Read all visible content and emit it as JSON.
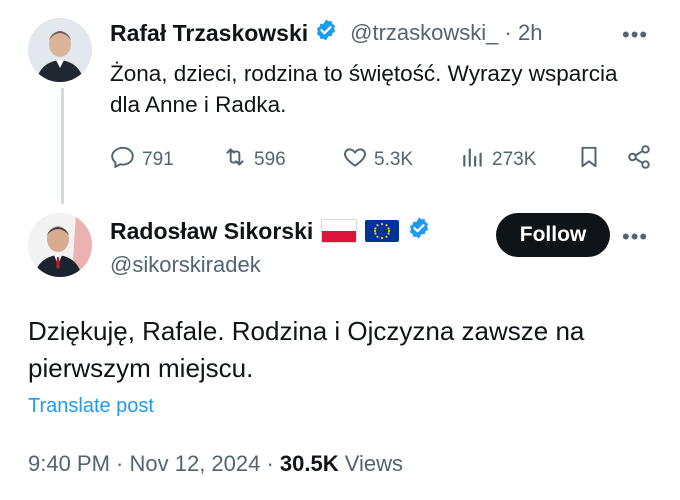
{
  "parent": {
    "name": "Rafał Trzaskowski",
    "handle": "@trzaskowski_",
    "time": "2h",
    "text": "Żona, dzieci, rodzina to świętość. Wyrazy wsparcia dla Anne i Radka.",
    "stats": {
      "replies": "791",
      "reposts": "596",
      "likes": "5.3K",
      "views": "273K"
    }
  },
  "main": {
    "name": "Radosław Sikorski",
    "handle": "@sikorskiradek",
    "follow_label": "Follow",
    "text": "Dziękuję, Rafale. Rodzina i Ojczyzna zawsze na pierwszym miejscu.",
    "translate_label": "Translate post",
    "timestamp": "9:40 PM · Nov 12, 2024 · ",
    "views_count": "30.5K",
    "views_label": "Views"
  },
  "more_icon_text": "•••",
  "colors": {
    "accent": "#1d9bf0",
    "verified": "#1d9bf0",
    "text_primary": "#0f1419",
    "text_secondary": "#536471",
    "follow_bg": "#0f1419"
  }
}
